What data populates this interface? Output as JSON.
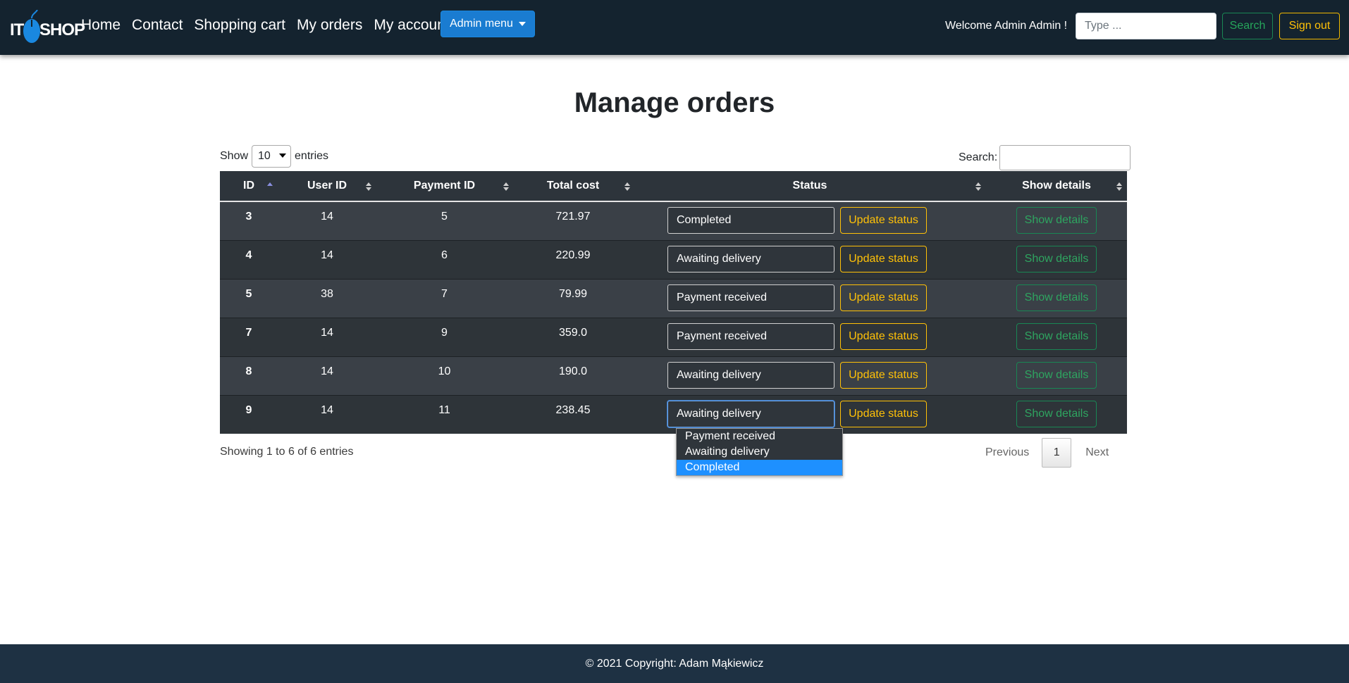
{
  "brand": {
    "left": "IT",
    "right": "SHOP"
  },
  "nav": {
    "links": [
      "Home",
      "Contact",
      "Shopping cart",
      "My orders",
      "My account"
    ],
    "admin_menu": "Admin menu",
    "welcome": "Welcome Admin Admin !",
    "search_placeholder": "Type ...",
    "search_button": "Search",
    "signout_button": "Sign out"
  },
  "page": {
    "title": "Manage orders"
  },
  "table_controls": {
    "show_label": "Show",
    "entries_value": "10",
    "entries_label": "entries",
    "search_label": "Search:"
  },
  "columns": [
    "ID",
    "User ID",
    "Payment ID",
    "Total cost",
    "Status",
    "Show details"
  ],
  "rows": [
    {
      "id": "3",
      "user_id": "14",
      "payment_id": "5",
      "total": "721.97",
      "status": "Completed",
      "update": "Update status",
      "details": "Show details"
    },
    {
      "id": "4",
      "user_id": "14",
      "payment_id": "6",
      "total": "220.99",
      "status": "Awaiting delivery",
      "update": "Update status",
      "details": "Show details"
    },
    {
      "id": "5",
      "user_id": "38",
      "payment_id": "7",
      "total": "79.99",
      "status": "Payment received",
      "update": "Update status",
      "details": "Show details"
    },
    {
      "id": "7",
      "user_id": "14",
      "payment_id": "9",
      "total": "359.0",
      "status": "Payment received",
      "update": "Update status",
      "details": "Show details"
    },
    {
      "id": "8",
      "user_id": "14",
      "payment_id": "10",
      "total": "190.0",
      "status": "Awaiting delivery",
      "update": "Update status",
      "details": "Show details"
    },
    {
      "id": "9",
      "user_id": "14",
      "payment_id": "11",
      "total": "238.45",
      "status": "Awaiting delivery",
      "update": "Update status",
      "details": "Show details"
    }
  ],
  "status_dropdown": {
    "options": [
      "Payment received",
      "Awaiting delivery",
      "Completed"
    ],
    "highlighted": "Completed"
  },
  "footer_info": "Showing 1 to 6 of 6 entries",
  "pagination": {
    "previous": "Previous",
    "current": "1",
    "next": "Next"
  },
  "footer": {
    "copyright": "© 2021 Copyright: Adam Mąkiewicz"
  },
  "colors": {
    "navbar_bg": "#14232f",
    "footer_bg": "#1e3143",
    "table_header_bg": "#2d343b",
    "row_odd_bg": "#3a4047",
    "row_even_bg": "#2e3439",
    "warning": "#ffc107",
    "success": "#198754",
    "primary": "#1a7cd1"
  },
  "icons": [
    "mouse-logo-icon",
    "caret-down-icon",
    "sort-asc-icon",
    "sort-both-icon"
  ]
}
